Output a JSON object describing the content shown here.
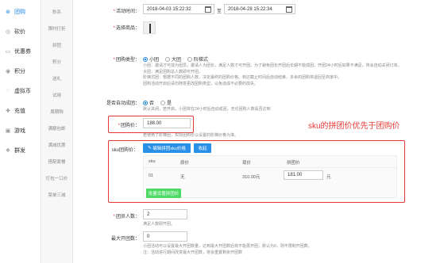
{
  "sidebar": {
    "items": [
      {
        "icon": "group-icon",
        "label": "团购",
        "active": true
      },
      {
        "icon": "bargain-icon",
        "label": "砍价"
      },
      {
        "icon": "coupon-icon",
        "label": "优惠券"
      },
      {
        "icon": "points-icon",
        "label": "积分"
      },
      {
        "icon": "virtual-coin-icon",
        "label": "虚拟币"
      },
      {
        "icon": "recharge-icon",
        "label": "充值"
      },
      {
        "icon": "game-icon",
        "label": "游戏"
      },
      {
        "icon": "group-buy-icon",
        "label": "群发"
      }
    ]
  },
  "subnav": {
    "items": [
      "秒杀",
      "限时打折",
      "拼团",
      "积分",
      "送礼",
      "试用",
      "周期购",
      "满额包邮",
      "满减优惠",
      "搭配套餐",
      "打包一口价",
      "菜单三减"
    ]
  },
  "form": {
    "time_label": "活动时间：",
    "start_time": "2018-04-03 15:22:32",
    "to": "至",
    "end_time": "2018-04-28 15:22:34",
    "product_label": "选择商品：",
    "type_label": "团购类型：",
    "type_options": [
      "小团",
      "大团",
      "阶梯式"
    ],
    "type_selected": "小团",
    "type_help": [
      "小团：邀请才可成为团员，邀请人为团长，满足人数才可开团。为了避免团长开团后长期不能成团，开团24小时后如果不满足，将会自动关闭订单。",
      "大团：满足团购总人数即可开团。",
      "阶梯式团：根据不同的团购人数，决定最终的团购价格。到达截止时间后自动结束，多余的团购将退回至商家中。",
      "团购活动开启后请勿随意更改团购类型，以免造成不必要的损失。"
    ],
    "auto_label": "是否自动成团：",
    "auto_options": [
      "否",
      "是"
    ],
    "auto_selected": "否",
    "auto_help": "默认关闭，若开启，小团将在24小时后自动成团，无论团购人数是否达到",
    "price_label": "团购价：",
    "price_value": "188.00",
    "price_help": "若使用了阶梯团，实际团购价以设置的阶梯价格为准。",
    "sku_label": "sku团购价：",
    "sku_edit_btn": "编辑拼团sku价格",
    "sku_collapse_btn": "收起",
    "sku_headers": [
      "sku",
      "原价",
      "现价",
      "拼团价"
    ],
    "sku_row": {
      "sku": "01",
      "original": "无",
      "current": "310.00元",
      "group_price": "181.00",
      "unit": "元"
    },
    "sku_batch_btn": "批量设置拼团价",
    "members_label": "团员人数：",
    "members_value": "2",
    "members_help": "满足人数即开团。",
    "max_label": "最大开团数：",
    "max_value": "0",
    "max_help": [
      "小团活动可以设置最大开团数量，达到最大开团数后将不能再开团；默认为0，则不限制开团数。",
      "注：活动进行期间改变最大开团数，将会重置剩余开团数"
    ]
  },
  "annotation": "sku的拼团价优先于团购价",
  "colors": {
    "accent": "#1e88e5",
    "red": "#e53935",
    "green": "#4cd964"
  }
}
